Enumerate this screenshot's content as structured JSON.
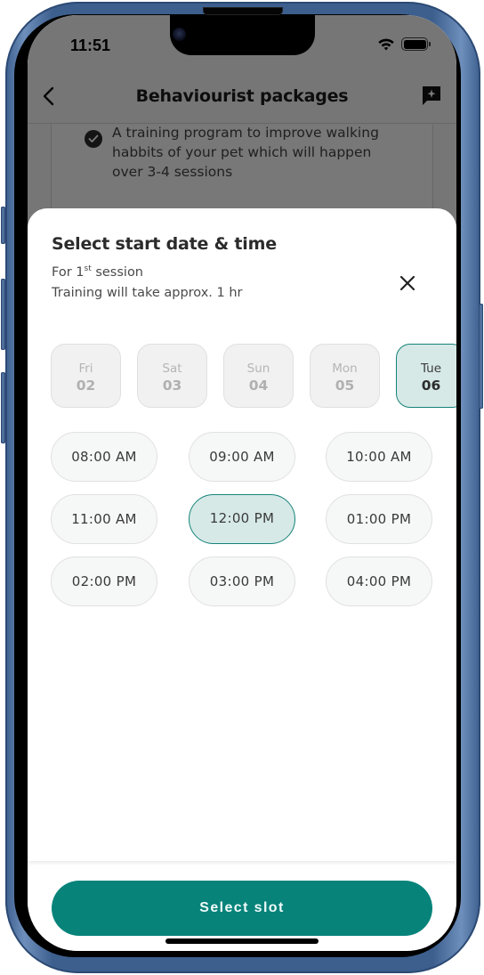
{
  "status_bar": {
    "time": "11:51",
    "icons": [
      "wifi-icon",
      "battery-icon"
    ]
  },
  "header": {
    "title": "Behaviourist packages",
    "back_icon": "chevron-left-icon",
    "action_icon": "chat-sparkle-icon"
  },
  "background_card": {
    "feature_text": "A training program to improve walking habbits of your pet which will happen over 3-4 sessions",
    "feature_icon": "check-circle-icon"
  },
  "sheet": {
    "title": "Select start date & time",
    "session_prefix": "For 1",
    "session_ordinal_suffix": "st",
    "session_suffix": " session",
    "duration_text": "Training will take approx. 1 hr",
    "close_icon": "close-icon",
    "dates": [
      {
        "day": "Fri",
        "date": "02",
        "selected": false
      },
      {
        "day": "Sat",
        "date": "03",
        "selected": false
      },
      {
        "day": "Sun",
        "date": "04",
        "selected": false
      },
      {
        "day": "Mon",
        "date": "05",
        "selected": false
      },
      {
        "day": "Tue",
        "date": "06",
        "selected": true
      }
    ],
    "times": [
      {
        "label": "08:00 AM",
        "selected": false
      },
      {
        "label": "09:00 AM",
        "selected": false
      },
      {
        "label": "10:00 AM",
        "selected": false
      },
      {
        "label": "11:00 AM",
        "selected": false
      },
      {
        "label": "12:00 PM",
        "selected": true
      },
      {
        "label": "01:00 PM",
        "selected": false
      },
      {
        "label": "02:00 PM",
        "selected": false
      },
      {
        "label": "03:00 PM",
        "selected": false
      },
      {
        "label": "04:00 PM",
        "selected": false
      }
    ],
    "primary_button": "Select slot"
  },
  "colors": {
    "accent": "#07837a",
    "selected_bg": "#d6e9e7",
    "selected_border": "#158379",
    "frame": "#3d5f8e"
  }
}
